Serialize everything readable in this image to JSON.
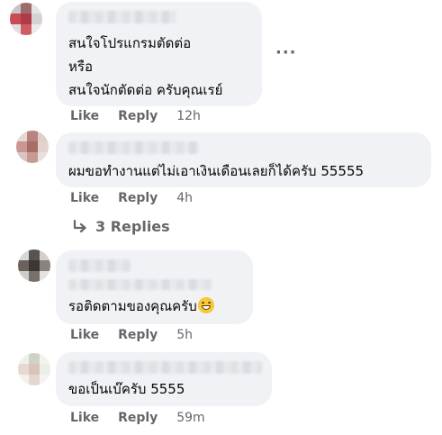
{
  "comments": [
    {
      "lines": [
        "สนใจโปรแกรมตัดต่อ",
        "หรือ",
        "สนใจนักตัดต่อ ครับคุณเรย์"
      ],
      "like_label": "Like",
      "reply_label": "Reply",
      "time": "12h",
      "avatar_colors": [
        "#c9c4c6",
        "#9d6a6e",
        "#e7e3e4",
        "#c84b56",
        "#b03b47",
        "#d6d1d3",
        "#e2dee0",
        "#cf5c64",
        "#ece9ea"
      ]
    },
    {
      "lines": [
        "ผมขอทำงานแต่ไม่เอาเงินเดือนเลยก็ได้ครับ 55555"
      ],
      "like_label": "Like",
      "reply_label": "Reply",
      "time": "4h",
      "avatar_colors": [
        "#e4d8d6",
        "#b8837e",
        "#dccfcc",
        "#c99790",
        "#a86d66",
        "#e2d3cf",
        "#d9c6c2",
        "#c79a94",
        "#eadfdc"
      ]
    },
    {
      "lines": [
        "รอติดตามของคุณครับ"
      ],
      "like_label": "Like",
      "reply_label": "Reply",
      "time": "5h",
      "avatar_colors": [
        "#d8d8d6",
        "#5a5450",
        "#d1d0ce",
        "#6b625c",
        "#3d3733",
        "#8a827c",
        "#cfcdcb",
        "#77706b",
        "#e3e2e0"
      ]
    },
    {
      "lines": [
        "ขอเป็นเบ๊ครับ 5555"
      ],
      "like_label": "Like",
      "reply_label": "Reply",
      "time": "59m",
      "avatar_colors": [
        "#eef0ea",
        "#cfd3c6",
        "#f2f3ef",
        "#e6d9d2",
        "#d9c4bb",
        "#eceee8",
        "#f1f2ee",
        "#e3d7d0",
        "#f4f5f2"
      ]
    }
  ],
  "replies_label": "3 Replies",
  "more_icon": "ellipsis-icon",
  "reply_icon": "reply-arrow-icon",
  "emoji_icon": "grinning-sweat-emoji-icon"
}
